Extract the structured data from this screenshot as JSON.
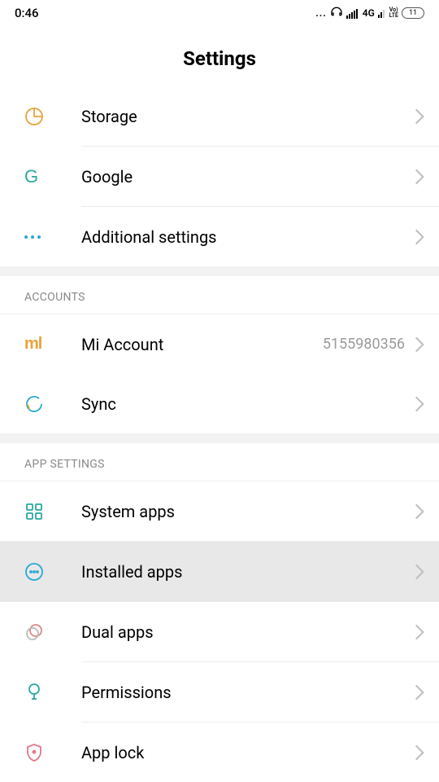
{
  "status": {
    "time": "0:46",
    "network": "4G",
    "volte": "Vo)\nLTE",
    "battery": "11"
  },
  "header": {
    "title": "Settings"
  },
  "sections": {
    "top": {
      "items": [
        {
          "label": "Storage"
        },
        {
          "label": "Google"
        },
        {
          "label": "Additional settings"
        }
      ]
    },
    "accounts": {
      "title": "ACCOUNTS",
      "items": [
        {
          "label": "Mi Account",
          "value": "5155980356"
        },
        {
          "label": "Sync"
        }
      ]
    },
    "app_settings": {
      "title": "APP SETTINGS",
      "items": [
        {
          "label": "System apps"
        },
        {
          "label": "Installed apps"
        },
        {
          "label": "Dual apps"
        },
        {
          "label": "Permissions"
        },
        {
          "label": "App lock"
        }
      ]
    }
  }
}
